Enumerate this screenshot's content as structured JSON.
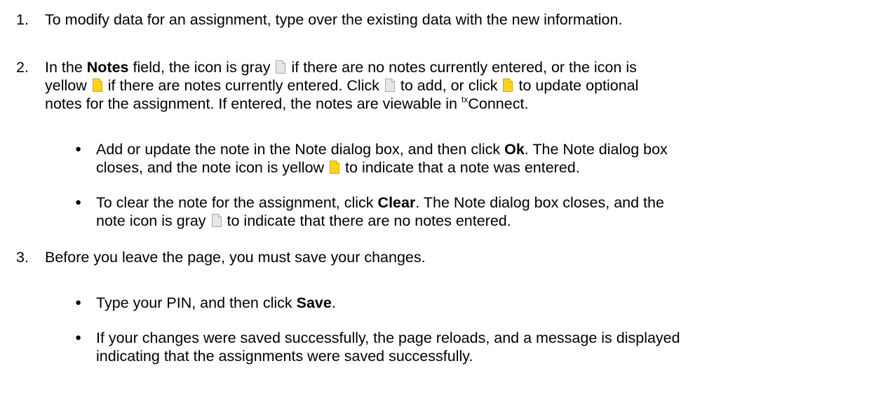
{
  "steps": [
    {
      "number": "1.",
      "text": "To modify data for an assignment, type over the existing data with the new information."
    },
    {
      "number": "2.",
      "in_the": "In the",
      "notes_label": "Notes",
      "field_text": "field, the icon is gray",
      "no_notes_text": "if there are no notes currently entered, or the icon is",
      "yellow_text": "yellow",
      "notes_entered_text": "if there are notes currently entered. Click",
      "to_add_text": "to add, or click",
      "to_update_text": "to update optional",
      "viewable_text": "notes for the assignment. If entered, the notes are viewable in",
      "tx_sup": "tx",
      "connect_text": "Connect.",
      "bullets": [
        {
          "line1_a": "Add or update the note in the Note dialog box, and then click",
          "bold": "Ok",
          "line1_b": ". The Note dialog box",
          "line2_a": "closes, and the note icon is yellow",
          "line2_b": "to indicate that a note was entered."
        },
        {
          "line1_a": "To clear the note for the assignment, click",
          "bold": "Clear",
          "line1_b": ". The Note dialog box closes, and the",
          "line2_a": "note icon is gray",
          "line2_b": "to indicate that there are no notes entered."
        }
      ]
    },
    {
      "number": "3.",
      "text": "Before you leave the page, you must save your changes.",
      "bullets": [
        {
          "line1_a": "Type your PIN, and then click",
          "bold": "Save",
          "line1_b": "."
        },
        {
          "line1": "If your changes were saved successfully, the page reloads, and a message is displayed",
          "line2": "indicating that the assignments were saved successfully."
        }
      ]
    }
  ],
  "icons": {
    "gray_note": "gray-note-icon",
    "yellow_note": "yellow-note-icon",
    "gray_color": "#d8d8d8",
    "yellow_color": "#f5d200"
  }
}
